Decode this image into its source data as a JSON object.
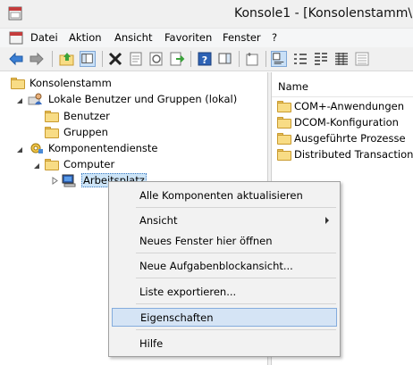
{
  "window": {
    "title": "Konsole1 - [Konsolenstamm\\"
  },
  "menubar": {
    "items": [
      "Datei",
      "Aktion",
      "Ansicht",
      "Favoriten",
      "Fenster",
      "?"
    ]
  },
  "toolbar": {
    "buttons": [
      "back-icon",
      "forward-icon",
      "up-folder-icon",
      "show-hide-tree-icon",
      "delete-icon",
      "properties-icon",
      "refresh-icon",
      "export-list-icon",
      "help-icon",
      "show-action-pane-icon",
      "new-window-icon",
      "large-icons-icon",
      "small-icons-icon",
      "list-view-icon",
      "detail-view-icon"
    ]
  },
  "tree": {
    "root": "Konsolenstamm",
    "local_users": "Lokale Benutzer und Gruppen (lokal)",
    "users": "Benutzer",
    "groups": "Gruppen",
    "component_services": "Komponentendienste",
    "computer": "Computer",
    "my_computer": "Arbeitsplatz"
  },
  "list": {
    "column_name": "Name",
    "items": [
      "COM+-Anwendungen",
      "DCOM-Konfiguration",
      "Ausgeführte Prozesse",
      "Distributed Transaction C"
    ]
  },
  "context_menu": {
    "refresh_all": "Alle Komponenten aktualisieren",
    "view": "Ansicht",
    "new_window": "Neues Fenster hier öffnen",
    "new_taskpad": "Neue Aufgabenblockansicht...",
    "export_list": "Liste exportieren...",
    "properties": "Eigenschaften",
    "help": "Hilfe"
  }
}
